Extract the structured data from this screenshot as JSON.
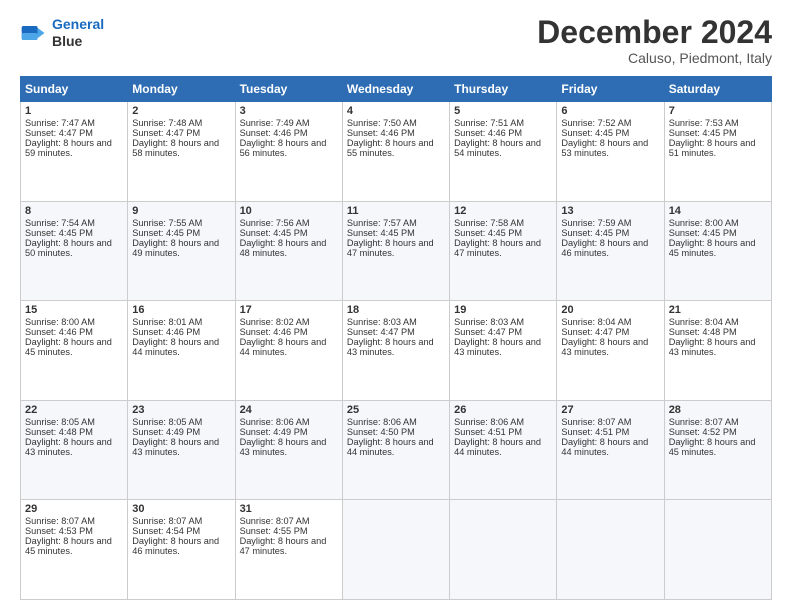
{
  "header": {
    "logo_line1": "General",
    "logo_line2": "Blue",
    "month": "December 2024",
    "location": "Caluso, Piedmont, Italy"
  },
  "days_of_week": [
    "Sunday",
    "Monday",
    "Tuesday",
    "Wednesday",
    "Thursday",
    "Friday",
    "Saturday"
  ],
  "weeks": [
    [
      {
        "day": 1,
        "sunrise": "7:47 AM",
        "sunset": "4:47 PM",
        "daylight": "8 hours and 59 minutes."
      },
      {
        "day": 2,
        "sunrise": "7:48 AM",
        "sunset": "4:47 PM",
        "daylight": "8 hours and 58 minutes."
      },
      {
        "day": 3,
        "sunrise": "7:49 AM",
        "sunset": "4:46 PM",
        "daylight": "8 hours and 56 minutes."
      },
      {
        "day": 4,
        "sunrise": "7:50 AM",
        "sunset": "4:46 PM",
        "daylight": "8 hours and 55 minutes."
      },
      {
        "day": 5,
        "sunrise": "7:51 AM",
        "sunset": "4:46 PM",
        "daylight": "8 hours and 54 minutes."
      },
      {
        "day": 6,
        "sunrise": "7:52 AM",
        "sunset": "4:45 PM",
        "daylight": "8 hours and 53 minutes."
      },
      {
        "day": 7,
        "sunrise": "7:53 AM",
        "sunset": "4:45 PM",
        "daylight": "8 hours and 51 minutes."
      }
    ],
    [
      {
        "day": 8,
        "sunrise": "7:54 AM",
        "sunset": "4:45 PM",
        "daylight": "8 hours and 50 minutes."
      },
      {
        "day": 9,
        "sunrise": "7:55 AM",
        "sunset": "4:45 PM",
        "daylight": "8 hours and 49 minutes."
      },
      {
        "day": 10,
        "sunrise": "7:56 AM",
        "sunset": "4:45 PM",
        "daylight": "8 hours and 48 minutes."
      },
      {
        "day": 11,
        "sunrise": "7:57 AM",
        "sunset": "4:45 PM",
        "daylight": "8 hours and 47 minutes."
      },
      {
        "day": 12,
        "sunrise": "7:58 AM",
        "sunset": "4:45 PM",
        "daylight": "8 hours and 47 minutes."
      },
      {
        "day": 13,
        "sunrise": "7:59 AM",
        "sunset": "4:45 PM",
        "daylight": "8 hours and 46 minutes."
      },
      {
        "day": 14,
        "sunrise": "8:00 AM",
        "sunset": "4:45 PM",
        "daylight": "8 hours and 45 minutes."
      }
    ],
    [
      {
        "day": 15,
        "sunrise": "8:00 AM",
        "sunset": "4:46 PM",
        "daylight": "8 hours and 45 minutes."
      },
      {
        "day": 16,
        "sunrise": "8:01 AM",
        "sunset": "4:46 PM",
        "daylight": "8 hours and 44 minutes."
      },
      {
        "day": 17,
        "sunrise": "8:02 AM",
        "sunset": "4:46 PM",
        "daylight": "8 hours and 44 minutes."
      },
      {
        "day": 18,
        "sunrise": "8:03 AM",
        "sunset": "4:47 PM",
        "daylight": "8 hours and 43 minutes."
      },
      {
        "day": 19,
        "sunrise": "8:03 AM",
        "sunset": "4:47 PM",
        "daylight": "8 hours and 43 minutes."
      },
      {
        "day": 20,
        "sunrise": "8:04 AM",
        "sunset": "4:47 PM",
        "daylight": "8 hours and 43 minutes."
      },
      {
        "day": 21,
        "sunrise": "8:04 AM",
        "sunset": "4:48 PM",
        "daylight": "8 hours and 43 minutes."
      }
    ],
    [
      {
        "day": 22,
        "sunrise": "8:05 AM",
        "sunset": "4:48 PM",
        "daylight": "8 hours and 43 minutes."
      },
      {
        "day": 23,
        "sunrise": "8:05 AM",
        "sunset": "4:49 PM",
        "daylight": "8 hours and 43 minutes."
      },
      {
        "day": 24,
        "sunrise": "8:06 AM",
        "sunset": "4:49 PM",
        "daylight": "8 hours and 43 minutes."
      },
      {
        "day": 25,
        "sunrise": "8:06 AM",
        "sunset": "4:50 PM",
        "daylight": "8 hours and 44 minutes."
      },
      {
        "day": 26,
        "sunrise": "8:06 AM",
        "sunset": "4:51 PM",
        "daylight": "8 hours and 44 minutes."
      },
      {
        "day": 27,
        "sunrise": "8:07 AM",
        "sunset": "4:51 PM",
        "daylight": "8 hours and 44 minutes."
      },
      {
        "day": 28,
        "sunrise": "8:07 AM",
        "sunset": "4:52 PM",
        "daylight": "8 hours and 45 minutes."
      }
    ],
    [
      {
        "day": 29,
        "sunrise": "8:07 AM",
        "sunset": "4:53 PM",
        "daylight": "8 hours and 45 minutes."
      },
      {
        "day": 30,
        "sunrise": "8:07 AM",
        "sunset": "4:54 PM",
        "daylight": "8 hours and 46 minutes."
      },
      {
        "day": 31,
        "sunrise": "8:07 AM",
        "sunset": "4:55 PM",
        "daylight": "8 hours and 47 minutes."
      },
      null,
      null,
      null,
      null
    ]
  ]
}
